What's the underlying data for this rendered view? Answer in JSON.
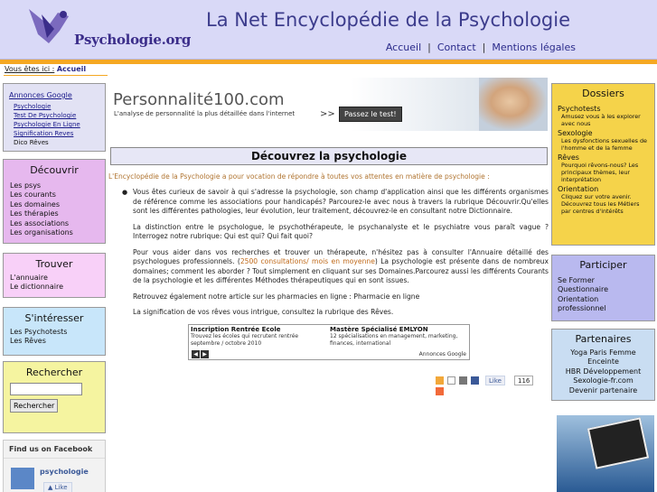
{
  "header": {
    "logo_text": "Psychologie.org",
    "site_title": "La Net Encyclopédie de la Psychologie",
    "nav": [
      "Accueil",
      "Contact",
      "Mentions légales"
    ]
  },
  "breadcrumb": {
    "label": "Vous êtes ici :",
    "current": "Accueil"
  },
  "annonces": {
    "title": "Annonces Google",
    "items": [
      "Psychologie",
      "Test De Psychologie",
      "Psychologie En Ligne",
      "Signification Reves",
      "Dico Rêves"
    ]
  },
  "decouvrir": {
    "title": "Découvrir",
    "items": [
      "Les psys",
      "Les courants",
      "Les domaines",
      "Les thérapies",
      "Les associations",
      "Les organisations"
    ]
  },
  "trouver": {
    "title": "Trouver",
    "items": [
      "L'annuaire",
      "Le dictionnaire"
    ]
  },
  "interesser": {
    "title": "S'intéresser",
    "items": [
      "Les Psychotests",
      "Les Rêves"
    ]
  },
  "rechercher": {
    "title": "Rechercher",
    "button": "Rechercher",
    "input_value": ""
  },
  "facebook": {
    "title": "Find us on Facebook",
    "page_name": "psychologie",
    "like": "Like"
  },
  "banner": {
    "title": "Personnalité100.com",
    "subtitle": "L'analyse de personnalité la plus détaillée dans l'internet",
    "arrows": ">>",
    "button": "Passez le test!"
  },
  "main": {
    "heading": "Découvrez la psychologie",
    "intro": "L'Encyclopédie de la Psychologie a pour vocation de répondre à toutes vos attentes en matière de psychologie :",
    "p1": "Vous êtes curieux de savoir à qui s'adresse la psychologie, son champ d'application ainsi que les différents organismes de référence comme les associations pour handicapés? Parcourez-le avec nous à travers la rubrique Découvrir.Qu'elles sont les différentes pathologies, leur évolution, leur traitement, découvrez-le en consultant notre Dictionnaire.",
    "p2": "La distinction entre le psychologue, le psychothérapeute, le psychanalyste et le psychiatre vous paraît vague ? Interrogez notre rubrique: Qui est qui? Qui fait quoi?",
    "p3a": "Pour vous aider dans vos recherches et trouver un thérapeute, n'hésitez pas à consulter l'Annuaire détaillé des psychologues professionnels. (",
    "p3_highlight": "2500 consultations/ mois en moyenne",
    "p3b": ") La psychologie est présente dans de nombreux domaines; comment les aborder ? Tout simplement en cliquant sur ses Domaines.Parcourez aussi les différents Courants de la psychologie et les différentes Méthodes thérapeutiques qui en sont issues.",
    "p4": "Retrouvez également notre article sur les pharmacies en ligne : Pharmacie en ligne",
    "p5": "La signification de vos rêves vous intrigue, consultez la rubrique des Rêves."
  },
  "ad": {
    "left_title": "Inscription Rentrée Ecole",
    "left_desc": "Trouvez les écoles qui recrutent rentrée septembre / octobre 2010",
    "right_title": "Mastère Spécialisé EMLYON",
    "right_desc": "12 spécialisations en management, marketing, finances, international",
    "footer": "Annonces Google"
  },
  "share": {
    "like": "Like",
    "count": "116"
  },
  "dossiers": {
    "title": "Dossiers",
    "sections": [
      {
        "name": "Psychotests",
        "desc": "Amusez vous à les explorer avec nous"
      },
      {
        "name": "Sexologie",
        "desc": "Les dysfonctions sexuelles de l'homme et de la femme"
      },
      {
        "name": "Rêves",
        "desc": "Pourquoi rêvons-nous? Les principaux thèmes, leur interprétation"
      },
      {
        "name": "Orientation",
        "desc": "Cliquez sur votre avenir. Découvrez tous les Métiers par centres d'intérêts"
      }
    ]
  },
  "participer": {
    "title": "Participer",
    "items": [
      "Se Former",
      "Questionnaire",
      "Orientation",
      "professionnel"
    ]
  },
  "partenaires": {
    "title": "Partenaires",
    "items": [
      "Yoga Paris Femme",
      "Enceinte",
      "HBR Développement",
      "Sexologie-fr.com",
      "Devenir partenaire"
    ]
  }
}
